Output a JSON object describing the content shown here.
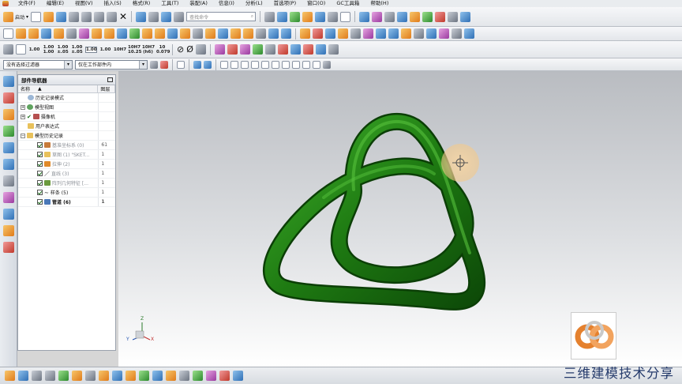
{
  "menu": {
    "items": [
      "文件(F)",
      "编辑(E)",
      "视图(V)",
      "插入(S)",
      "格式(R)",
      "工具(T)",
      "装配(A)",
      "信息(I)",
      "分析(L)",
      "首选项(P)",
      "窗口(O)",
      "GC工具箱",
      "帮助(H)"
    ]
  },
  "toolbar": {
    "start_label": "启动",
    "search_placeholder": "查找命令",
    "num_buttons": [
      "1.00",
      "1.00\n1.00",
      "1.00\n±.05",
      "1.00\n±.05",
      "1.00",
      "1.00",
      "10H7",
      "10H7\n10.25",
      "10H7\n(h6)",
      "10\n0.079"
    ]
  },
  "filters": {
    "selection_filter": "没有选择过滤器",
    "assembly_scope": "仅在工作部件内"
  },
  "navigator": {
    "title": "部件导航器",
    "col_name": "名称",
    "col_layer": "图层",
    "rows": [
      {
        "label": "历史记录模式",
        "layer": "",
        "dim": false
      },
      {
        "label": "模型视图",
        "layer": "",
        "dim": false
      },
      {
        "label": "摄像机",
        "layer": "",
        "dim": false
      },
      {
        "label": "用户表达式",
        "layer": "",
        "dim": false
      },
      {
        "label": "模型历史记录",
        "layer": "",
        "dim": false
      },
      {
        "label": "基准坐标系 (0)",
        "layer": "61",
        "dim": true
      },
      {
        "label": "草图 (1) \"SKET...",
        "layer": "1",
        "dim": true
      },
      {
        "label": "拉伸 (2)",
        "layer": "1",
        "dim": true
      },
      {
        "label": "直线 (3)",
        "layer": "1",
        "dim": true
      },
      {
        "label": "阵列几何特征 [...",
        "layer": "1",
        "dim": true
      },
      {
        "label": "样条 (5)",
        "layer": "1",
        "dim": false
      },
      {
        "label": "管道 (6)",
        "layer": "1",
        "dim": false
      }
    ]
  },
  "viewport": {
    "model_color": "#1e7a12",
    "highlight_color": "#f3c98a"
  },
  "axes": {
    "z": "Z",
    "x": "X",
    "y": "Y"
  },
  "watermark": "三维建模技术分享"
}
